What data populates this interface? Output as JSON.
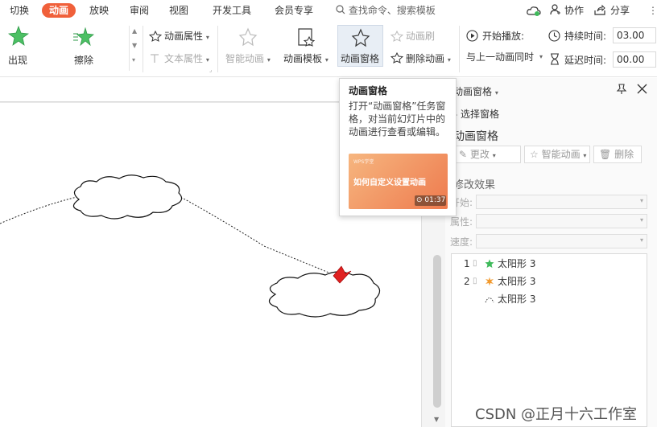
{
  "menu": {
    "tabs": [
      "切换",
      "动画",
      "放映",
      "审阅",
      "视图",
      "开发工具",
      "会员专享"
    ],
    "active": "动画",
    "search_placeholder": "查找命令、搜索模板",
    "collab": "协作",
    "share": "分享"
  },
  "ribbon": {
    "effect_appear": "出现",
    "effect_erase": "擦除",
    "anim_props": "动画属性",
    "text_props": "文本属性",
    "smart_anim": "智能动画",
    "anim_template": "动画模板",
    "anim_pane": "动画窗格",
    "anim_brush": "动画刷",
    "delete_anim": "删除动画",
    "start_play_label": "开始播放:",
    "start_play_value": "与上一动画同时",
    "duration_label": "持续时间:",
    "duration_value": "03.00",
    "delay_label": "延迟时间:",
    "delay_value": "00.00"
  },
  "tooltip": {
    "title": "动画窗格",
    "desc": "打开“动画窗格”任务窗格，对当前幻灯片中的动画进行查看或编辑。",
    "thumb_brand": "WPS学堂",
    "thumb_title": "如何自定义设置动画",
    "duration": "01:37"
  },
  "panel": {
    "header": "动画窗格",
    "select_pane": "选择窗格",
    "title": "动画窗格",
    "change_btn": "更改",
    "smart_btn": "智能动画",
    "delete_btn": "删除",
    "modify_label": "修改效果",
    "start_label": "开始:",
    "prop_label": "属性:",
    "speed_label": "速度:",
    "items": [
      {
        "num": "1",
        "name": "太阳形 3",
        "icon": "star-green-icon"
      },
      {
        "num": "2",
        "name": "太阳形 3",
        "icon": "burst-orange-icon"
      },
      {
        "num": "",
        "name": "太阳形 3",
        "icon": "arc-path-icon"
      }
    ]
  },
  "watermark": "CSDN @正月十六工作室",
  "colors": {
    "accent": "#f0603a",
    "green": "#3fba5b"
  }
}
